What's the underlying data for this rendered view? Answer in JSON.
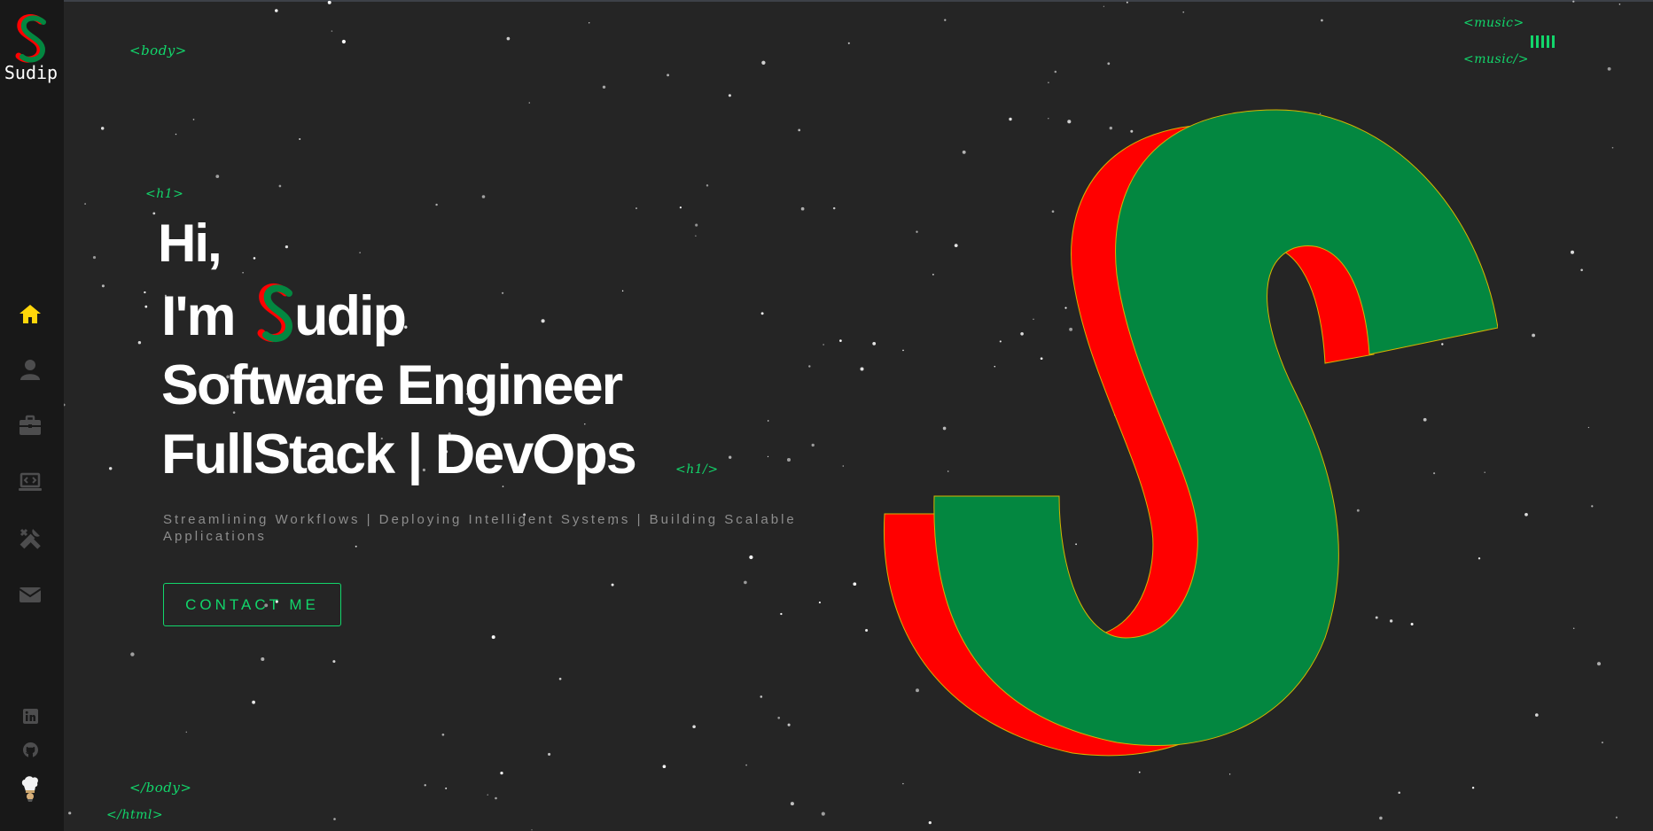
{
  "brand": {
    "logo_letter": "S",
    "name": "Sudip"
  },
  "colors": {
    "accent": "#12d66b",
    "s_green": "#038740",
    "s_red": "#ff0000",
    "home_active": "#ffd60a",
    "nav_idle": "#4d4d4e"
  },
  "nav": [
    {
      "icon": "home-icon",
      "label": "Home",
      "active": true
    },
    {
      "icon": "user-icon",
      "label": "About"
    },
    {
      "icon": "briefcase-icon",
      "label": "Experience"
    },
    {
      "icon": "laptop-code-icon",
      "label": "Projects"
    },
    {
      "icon": "tools-icon",
      "label": "Skills"
    },
    {
      "icon": "envelope-icon",
      "label": "Contact"
    }
  ],
  "social": [
    {
      "icon": "linkedin-icon"
    },
    {
      "icon": "github-icon"
    },
    {
      "icon": "chef-hat-icon"
    }
  ],
  "tags": {
    "body_open": "<body>",
    "h1_open": "<h1>",
    "h1_close": "<h1/>",
    "body_close": "</body>",
    "html_close": "</html>",
    "music_open": "<music>",
    "music_close": "<music/>"
  },
  "hero": {
    "line1": "Hi,",
    "line2_prefix": "I'm ",
    "line2_suffix": "udip",
    "line3": "Software Engineer",
    "line4": "FullStack | DevOps",
    "subtitle": "Streamlining Workflows | Deploying Intelligent Systems | Building Scalable Applications",
    "cta_label": "CONTACT ME"
  }
}
